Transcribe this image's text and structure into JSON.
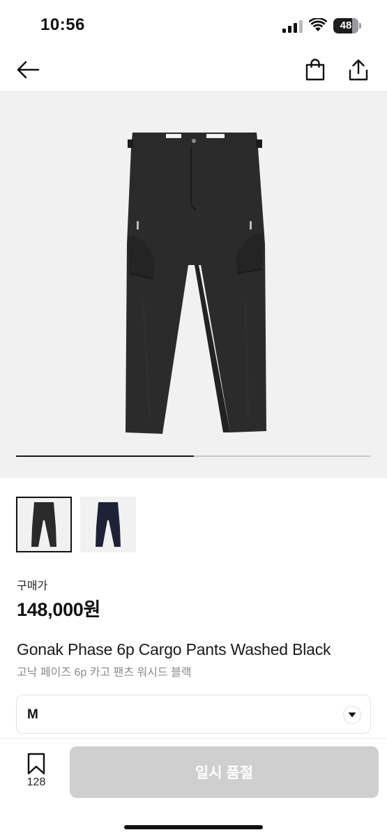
{
  "status_bar": {
    "time": "10:56",
    "battery": "48",
    "icons": [
      "signal-icon",
      "wifi-icon",
      "battery-icon"
    ]
  },
  "nav": {
    "icons": [
      "back-arrow-icon",
      "shopping-bag-icon",
      "share-icon"
    ]
  },
  "gallery": {
    "progress": 0.5,
    "thumbnails": [
      {
        "color": "black",
        "selected": true
      },
      {
        "color": "navy",
        "selected": false
      }
    ]
  },
  "product": {
    "price_label": "구매가",
    "price": "148,000원",
    "name_en": "Gonak Phase 6p Cargo Pants Washed Black",
    "name_ko": "고낙 페이즈 6p 카고 팬츠 워시드 블랙"
  },
  "size_select": {
    "value": "M",
    "icon": "chevron-down-icon"
  },
  "bottom_bar": {
    "wish_count": "128",
    "wish_icon": "bookmark-icon",
    "cta_label": "일시 품절"
  },
  "colors": {
    "cta_disabled": "#cfcfcf",
    "image_bg": "#f1f1f1",
    "pants_black": "#2a2a2a",
    "pants_navy": "#1e2236"
  }
}
